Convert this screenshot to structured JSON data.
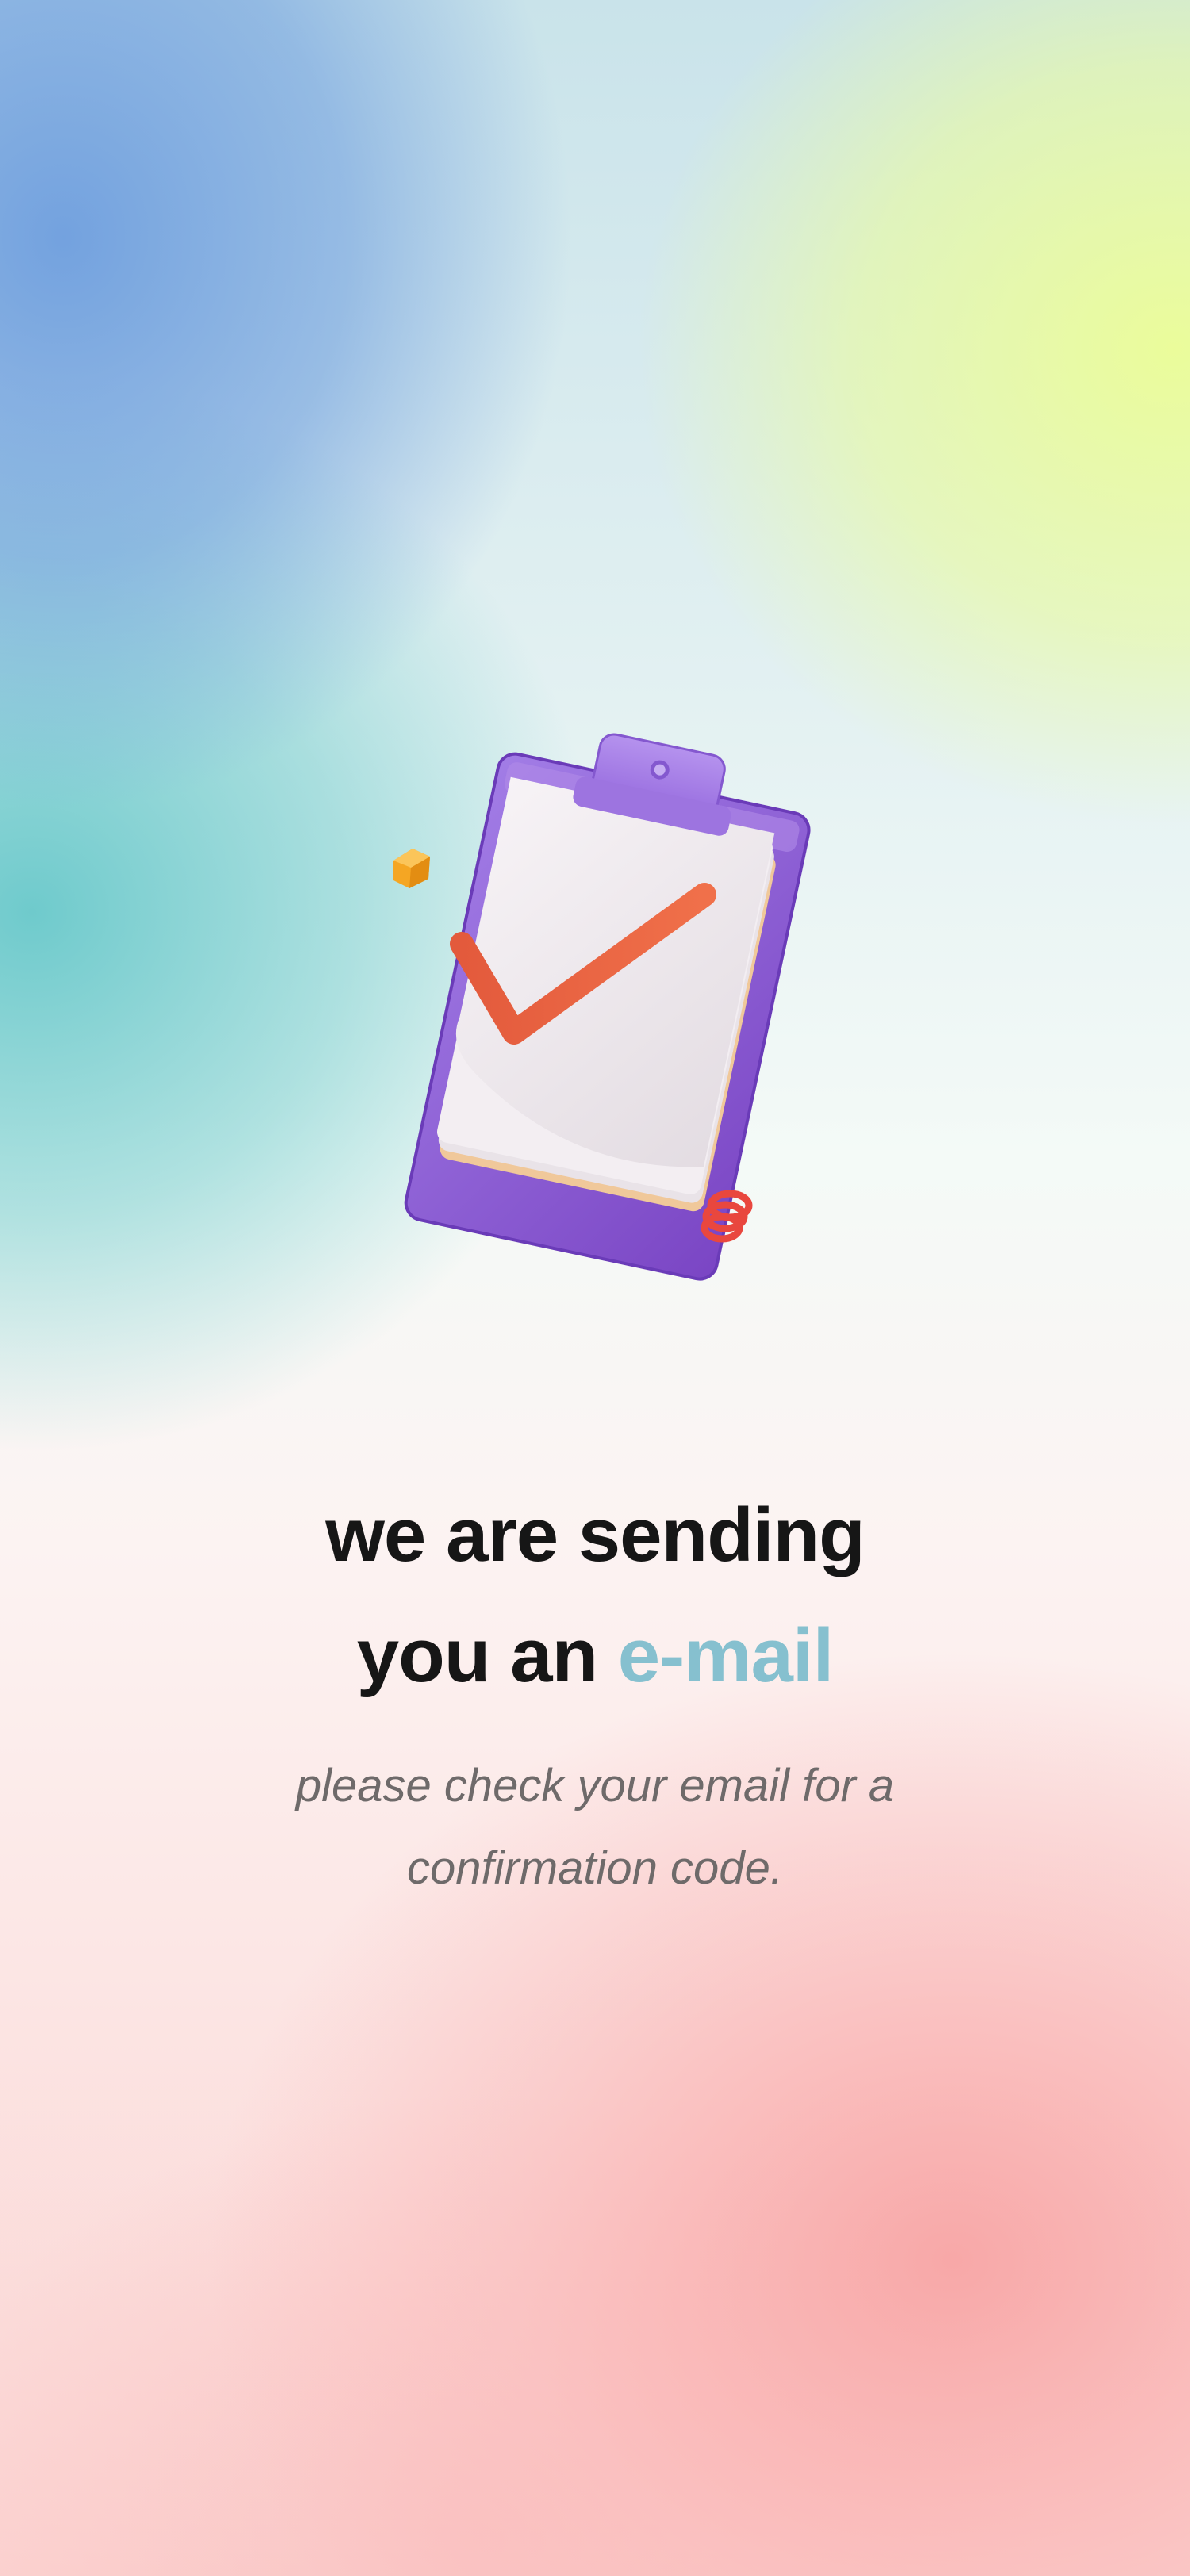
{
  "illustration": {
    "icon": "clipboard-checkmark-icon",
    "colors": {
      "clipboard": "#9b6fdc",
      "paper": "#efe9ec",
      "checkmark": "#e8603f",
      "cube": "#f5a623",
      "spring": "#e9473e"
    }
  },
  "headline": {
    "line1": "we are sending",
    "line2_prefix": "you an",
    "line2_accent": "e-mail",
    "accent_color": "#86c0cf"
  },
  "subtitle": {
    "line1": "please check your email for a",
    "line2": "confirmation code."
  }
}
